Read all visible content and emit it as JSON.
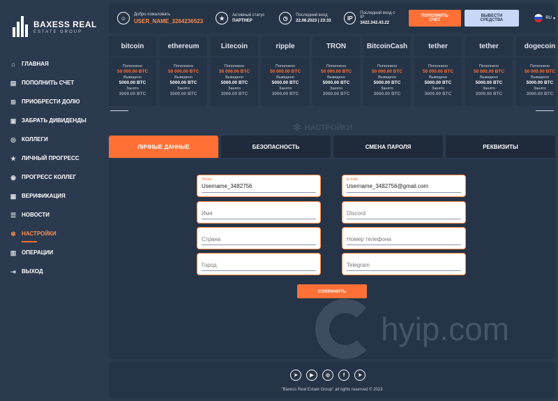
{
  "brand": {
    "title": "BAXESS REAL",
    "subtitle": "ESTATE GROUP"
  },
  "nav": [
    {
      "label": "ГЛАВНАЯ",
      "icon": "home-icon",
      "glyph": "⌂"
    },
    {
      "label": "ПОПОЛНИТЬ СЧЕТ",
      "icon": "deposit-icon",
      "glyph": "▤"
    },
    {
      "label": "ПРИОБРЕСТИ ДОЛЮ",
      "icon": "cart-icon",
      "glyph": "⊞"
    },
    {
      "label": "ЗАБРАТЬ ДИВИДЕНДЫ",
      "icon": "withdraw-icon",
      "glyph": "▣"
    },
    {
      "label": "КОЛЛЕГИ",
      "icon": "users-icon",
      "glyph": "◎"
    },
    {
      "label": "ЛИЧНЫЙ ПРОГРЕСС",
      "icon": "star-icon",
      "glyph": "★"
    },
    {
      "label": "ПРОГРЕСС КОЛЛЕГ",
      "icon": "team-icon",
      "glyph": "◉"
    },
    {
      "label": "ВЕРИФИКАЦИЯ",
      "icon": "id-card-icon",
      "glyph": "▦"
    },
    {
      "label": "НОВОСТИ",
      "icon": "list-icon",
      "glyph": "☰"
    },
    {
      "label": "НАСТРОЙКИ",
      "icon": "gear-icon",
      "glyph": "✻"
    },
    {
      "label": "ОПЕРАЦИИ",
      "icon": "operations-icon",
      "glyph": "▥"
    },
    {
      "label": "ВЫХОД",
      "icon": "logout-icon",
      "glyph": "⇥"
    }
  ],
  "topbar": {
    "welcome_label": "Добро пожаловать",
    "username": "USER_NAME_3264236523",
    "status_label": "Активный статус",
    "status_value": "ПАРТНЕР",
    "last_login_label": "Последний вход",
    "last_login_value": "22.06.2023 | 23:33",
    "last_ip_label": "Последний вход с IP",
    "last_ip_value": "3422.342.43.22",
    "ip_badge": "IP",
    "deposit_button": "ПОПОЛНИТЬ СЧЕТ",
    "withdraw_button": "ВЫВЕСТИ СРЕДСТВА",
    "lang": "RU"
  },
  "cards": [
    {
      "name": "bitcoin",
      "icon": "bitcoin-icon"
    },
    {
      "name": "ethereum",
      "icon": "ethereum-icon"
    },
    {
      "name": "Litecoin",
      "icon": "litecoin-icon"
    },
    {
      "name": "ripple",
      "icon": "ripple-icon"
    },
    {
      "name": "TRON",
      "icon": "tron-icon"
    },
    {
      "name": "BitcoinCash",
      "icon": "bitcoincash-icon"
    },
    {
      "name": "tether",
      "icon": "tether-icon"
    },
    {
      "name": "tether",
      "icon": "tether-icon"
    },
    {
      "name": "dogecoin",
      "icon": "dogecoin-icon"
    }
  ],
  "card_labels": {
    "deposited": "Пополнено",
    "withdrawn": "Выведено",
    "busy": "Занято"
  },
  "card_values": {
    "deposited": "50 000.00 BTC",
    "withdrawn": "5000.00 BTC",
    "busy": "3000.00 BTC"
  },
  "section_title": "НАСТРОЙКИ",
  "tabs": [
    "ЛИЧНЫЕ ДАННЫЕ",
    "БЕЗОПАСНОСТЬ",
    "СМЕНА ПАРОЛЯ",
    "РЕКВИЗИТЫ"
  ],
  "form": {
    "login_label": "Логин",
    "login_value": "Username_3482756",
    "email_label": "E-mail",
    "email_value": "Username_3482756@gmail.com",
    "name_placeholder": "Имя",
    "discord_placeholder": "Discord",
    "country_placeholder": "Страна",
    "phone_placeholder": "Номер телефона",
    "city_placeholder": "Город",
    "telegram_placeholder": "Telegram",
    "save_button": "СОХРАНИТЬ"
  },
  "watermark": "hyip.com",
  "footer": {
    "socials": [
      {
        "icon": "telegram-icon",
        "glyph": "➤"
      },
      {
        "icon": "youtube-icon",
        "glyph": "▶"
      },
      {
        "icon": "instagram-icon",
        "glyph": "◎"
      },
      {
        "icon": "facebook-icon",
        "glyph": "f"
      },
      {
        "icon": "telegram-icon",
        "glyph": "➤"
      }
    ],
    "copyright": "\"Baxess Real Estate Group\" all rights reserved © 2023"
  },
  "colors": {
    "accent": "#ff7036",
    "bg": "#2b3a4f",
    "panel": "#263447"
  }
}
